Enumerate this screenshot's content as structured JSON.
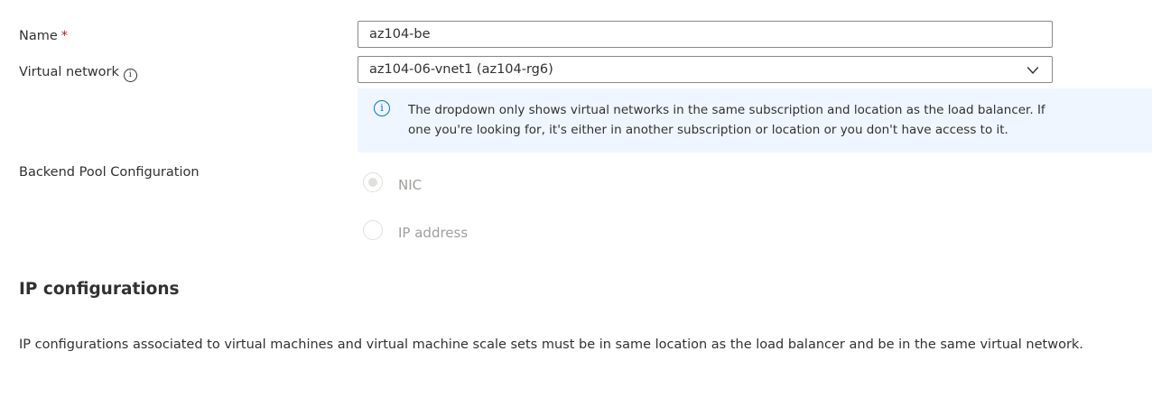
{
  "form": {
    "name": {
      "label": "Name",
      "required_mark": "*",
      "value": "az104-be"
    },
    "virtual_network": {
      "label": "Virtual network",
      "info_icon": "info-icon",
      "selected": "az104-06-vnet1 (az104-rg6)",
      "info_message_line1": "The dropdown only shows virtual networks in the same subscription and location as the load balancer. If",
      "info_message_line2": "one you're looking for, it's either in another subscription or location or you don't have access to it."
    },
    "backend_pool": {
      "label": "Backend Pool Configuration",
      "options": [
        {
          "label": "NIC",
          "checked": true,
          "disabled": true
        },
        {
          "label": "IP address",
          "checked": false,
          "disabled": true
        }
      ]
    }
  },
  "ip_configurations": {
    "title": "IP configurations",
    "description": "IP configurations associated to virtual machines and virtual machine scale sets must be in same location as the load balancer and be in the same virtual network."
  },
  "colors": {
    "required": "#a4262c",
    "info_accent": "#0078d4",
    "info_background": "#f0f6ff",
    "disabled_text": "#a19f9d",
    "border": "#8a8886"
  }
}
